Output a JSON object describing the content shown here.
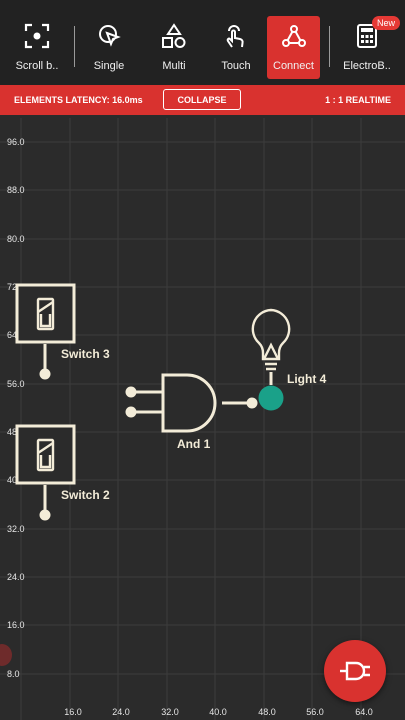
{
  "toolbar": {
    "items": [
      {
        "label": "Scroll b..",
        "icon": "scroll-frame-icon"
      },
      {
        "label": "Single",
        "icon": "cursor-icon"
      },
      {
        "label": "Multi",
        "icon": "shapes-icon"
      },
      {
        "label": "Touch",
        "icon": "touch-hand-icon"
      },
      {
        "label": "Connect",
        "icon": "connect-nodes-icon",
        "active": true
      },
      {
        "label": "ElectroB..",
        "icon": "calculator-icon",
        "badge": "New"
      }
    ]
  },
  "status": {
    "latency": "ELEMENTS LATENCY: 16.0ms",
    "collapse_label": "COLLAPSE",
    "mode": "1 : 1 REALTIME"
  },
  "grid": {
    "x_labels": [
      "16.0",
      "24.0",
      "32.0",
      "40.0",
      "48.0",
      "56.0",
      "64.0"
    ],
    "y_labels": [
      "96.0",
      "88.0",
      "80.0",
      "72",
      "64",
      "56.0",
      "48.0",
      "40",
      "32.0",
      "24.0",
      "16.0",
      "8.0"
    ]
  },
  "components": {
    "switch3": "Switch 3",
    "switch2": "Switch 2",
    "and1": "And 1",
    "light4": "Light 4"
  },
  "colors": {
    "accent": "#d9322f",
    "toolbar_bg": "#222222",
    "canvas_bg": "#2b2b2b",
    "component": "#f3ecd8",
    "node_active": "#1aa189"
  },
  "fab": {
    "icon": "plug-icon"
  }
}
